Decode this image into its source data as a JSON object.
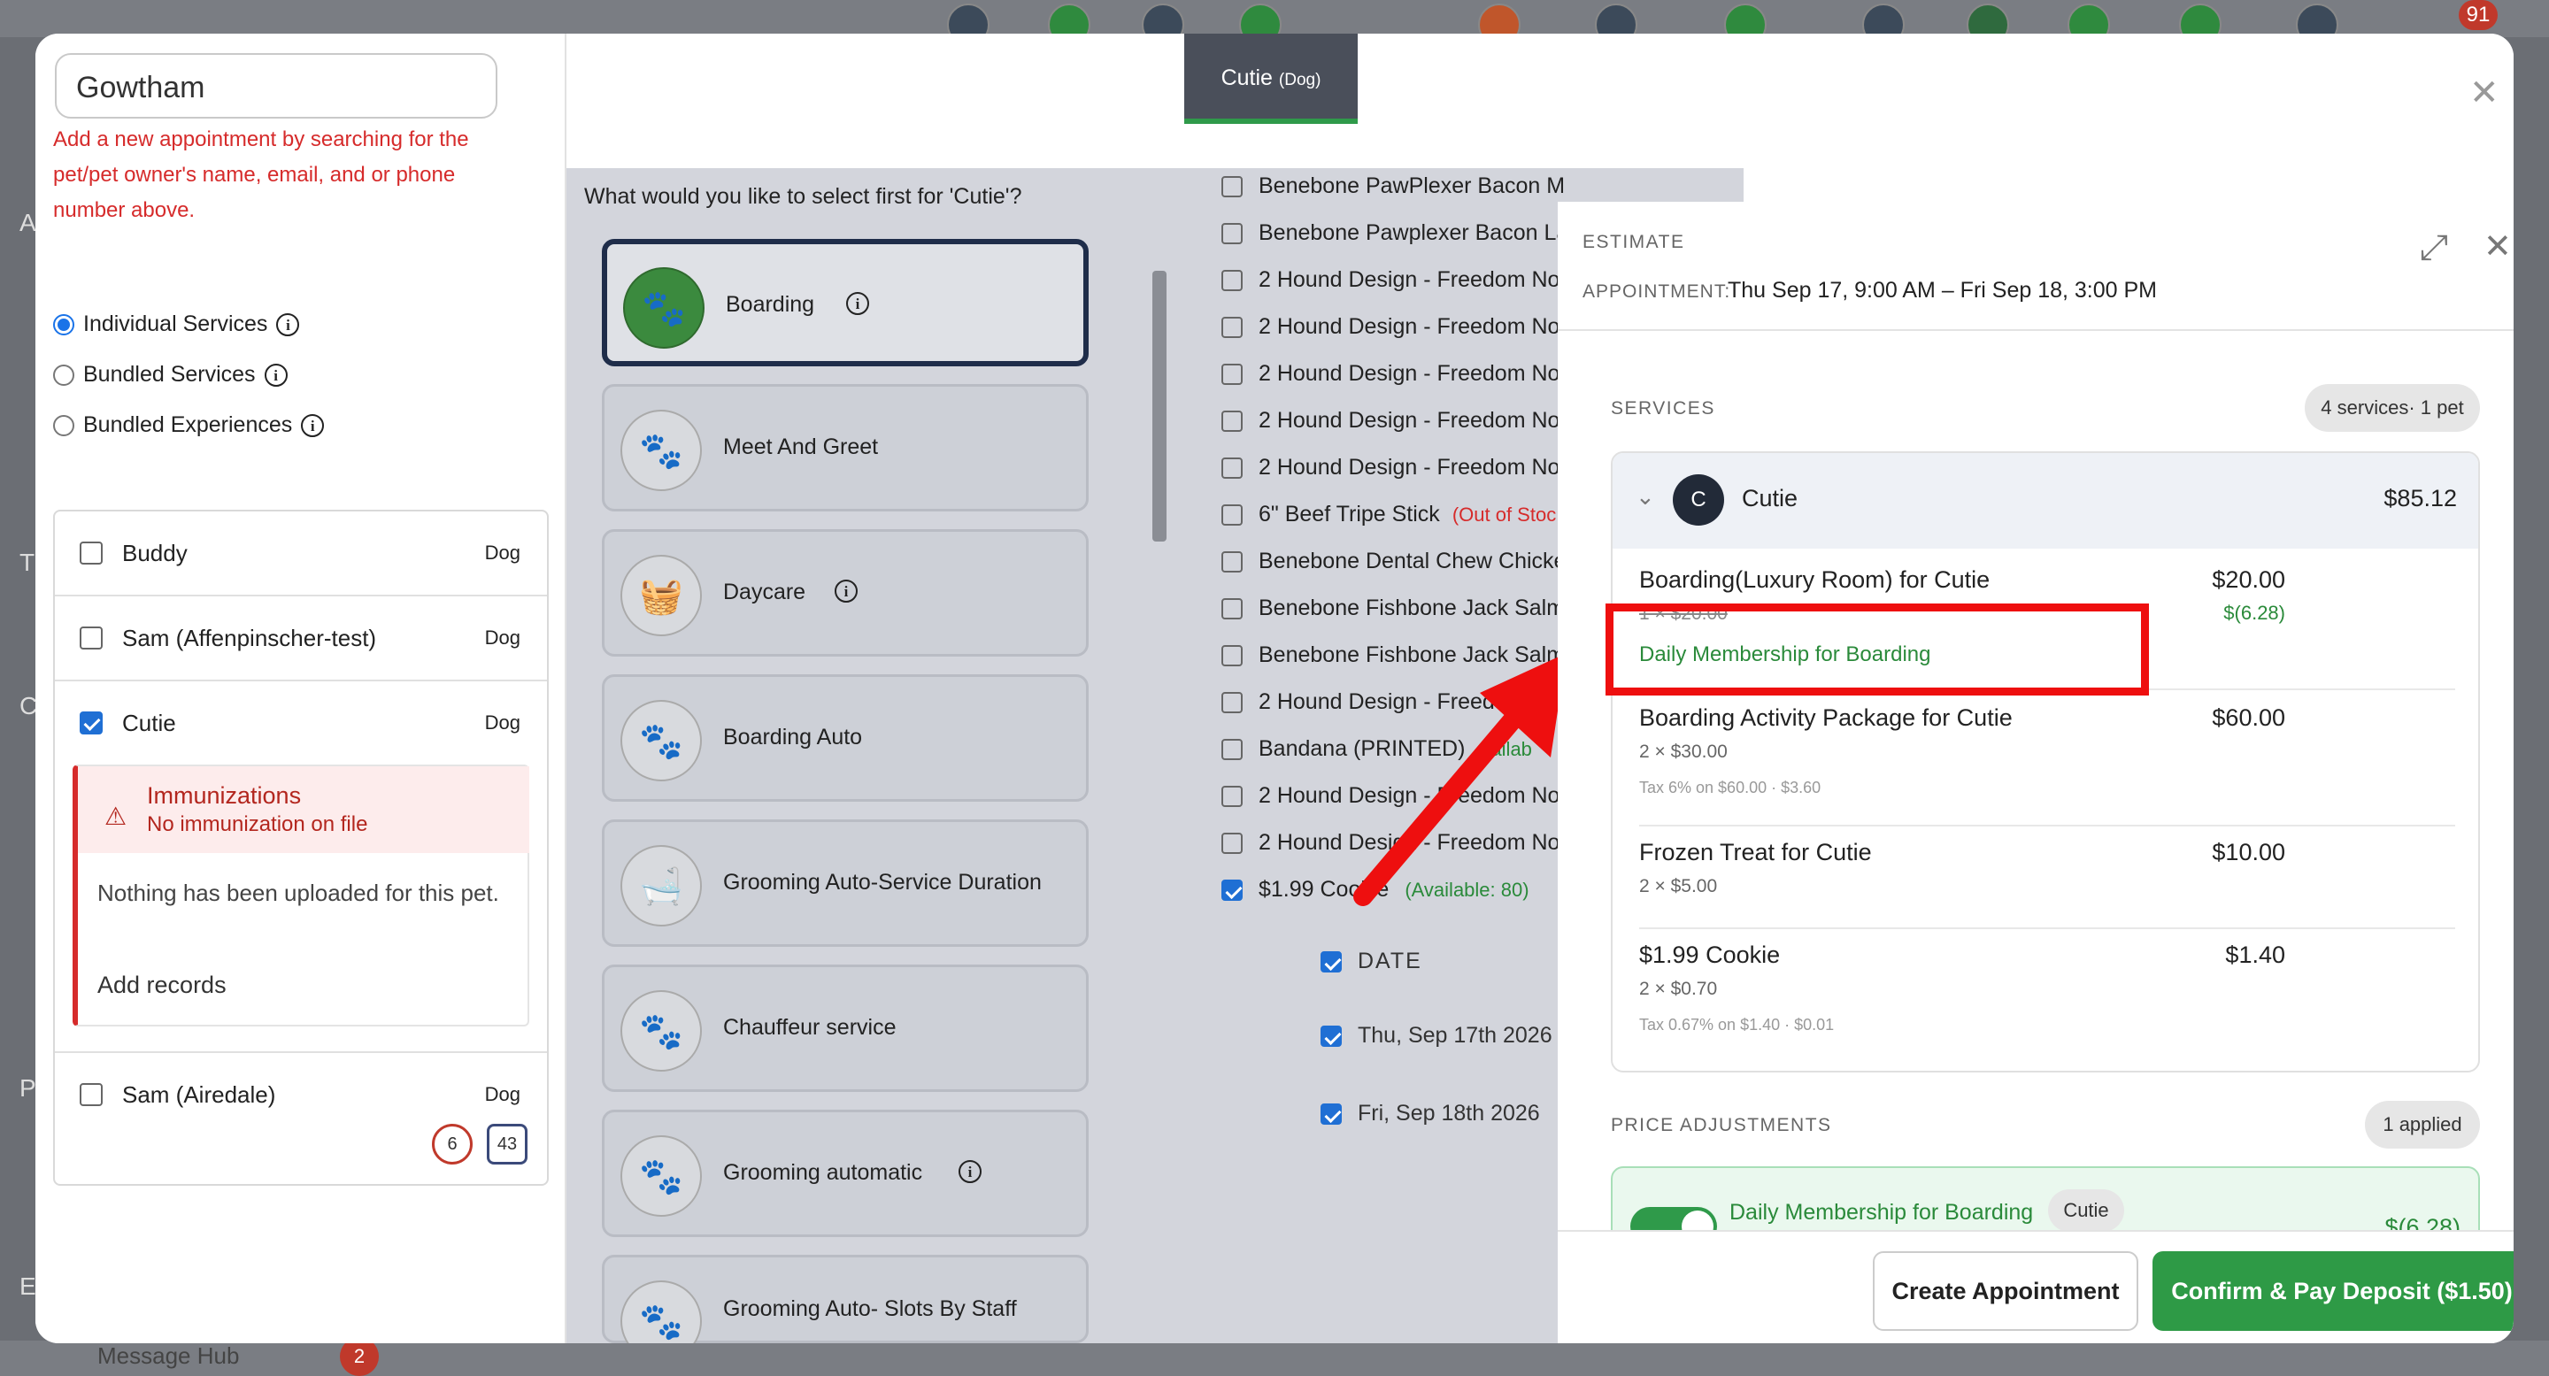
{
  "background": {
    "notification_count": "91",
    "left_letters": [
      "A",
      "T",
      "C",
      "P",
      "E"
    ],
    "bottom_label": "Message Hub",
    "bottom_count": "2"
  },
  "search": {
    "value": "Gowtham"
  },
  "error_text": "Add a new appointment by searching for the pet/pet owner's name, email, and or phone number above.",
  "service_type_options": [
    {
      "label": "Individual Services",
      "selected": true
    },
    {
      "label": "Bundled Services",
      "selected": false
    },
    {
      "label": "Bundled Experiences",
      "selected": false
    }
  ],
  "pets": [
    {
      "name": "Buddy",
      "species": "Dog",
      "checked": false
    },
    {
      "name": "Sam (Affenpinscher-test)",
      "species": "Dog",
      "checked": false
    },
    {
      "name": "Cutie",
      "species": "Dog",
      "checked": true
    },
    {
      "name": "Sam (Airedale)",
      "species": "Dog",
      "checked": false
    }
  ],
  "immunization": {
    "title": "Immunizations",
    "subtitle": "No immunization on file",
    "body": "Nothing has been uploaded for this pet.",
    "link": "Add records"
  },
  "pet_badges": {
    "count1": "6",
    "count2": "43"
  },
  "tab": {
    "name": "Cutie",
    "species": "(Dog)"
  },
  "question": "What would you like to select first for 'Cutie'?",
  "services": [
    "Boarding",
    "Meet And Greet",
    "Daycare",
    "Boarding Auto",
    "Grooming Auto-Service Duration",
    "Chauffeur service",
    "Grooming automatic",
    "Grooming Auto- Slots By Staff"
  ],
  "products": [
    {
      "name": "Benebone PawPlexer Bacon M",
      "checked": false
    },
    {
      "name": "Benebone Pawplexer Bacon La",
      "checked": false
    },
    {
      "name": "2 Hound Design - Freedom No",
      "checked": false
    },
    {
      "name": "2 Hound Design - Freedom No",
      "checked": false
    },
    {
      "name": "2 Hound Design - Freedom No",
      "checked": false
    },
    {
      "name": "2 Hound Design - Freedom No",
      "checked": false
    },
    {
      "name": "2 Hound Design - Freedom No",
      "checked": false
    },
    {
      "name": "6\" Beef Tripe Stick",
      "checked": false,
      "note": "(Out of Stoc"
    },
    {
      "name": "Benebone Dental Chew Chicke",
      "checked": false
    },
    {
      "name": "Benebone Fishbone Jack Salm",
      "checked": false
    },
    {
      "name": "Benebone Fishbone Jack Salm",
      "checked": false
    },
    {
      "name": "2 Hound Design - Freedom N",
      "checked": false
    },
    {
      "name": "Bandana (PRINTED)",
      "checked": false,
      "avail": "vailab"
    },
    {
      "name": "2 Hound Design - Freedom No",
      "checked": false
    },
    {
      "name": "2 Hound Design - Freedom No",
      "checked": false
    },
    {
      "name": "$1.99 Cookie",
      "checked": true,
      "avail": "(Available: 80)"
    }
  ],
  "dates": {
    "header": "DATE",
    "rows": [
      "Thu, Sep 17th 2026",
      "Fri, Sep 18th 2026"
    ]
  },
  "estimate": {
    "label": "ESTIMATE",
    "appointment_label": "APPOINTMENT:",
    "appointment_value": "Thu Sep 17, 9:00 AM – Fri Sep 18, 3:00 PM",
    "services_label": "SERVICES",
    "services_pill": "4 services· 1 pet",
    "pet_initial": "C",
    "pet_name": "Cutie",
    "pet_total": "$85.12",
    "lines": [
      {
        "title": "Boarding(Luxury Room) for Cutie",
        "price": "$20.00",
        "discount": "$(6.28)",
        "sub": "1 × $20.00",
        "membership": "Daily Membership for Boarding"
      },
      {
        "title": "Boarding Activity Package for Cutie",
        "price": "$60.00",
        "sub": "2 × $30.00",
        "tax": "Tax 6% on $60.00 · $3.60"
      },
      {
        "title": "Frozen Treat for Cutie",
        "price": "$10.00",
        "sub": "2 × $5.00"
      },
      {
        "title": "$1.99 Cookie",
        "price": "$1.40",
        "sub": "2 × $0.70",
        "tax": "Tax 0.67% on $1.40 · $0.01"
      }
    ],
    "adjust_label": "PRICE ADJUSTMENTS",
    "adjust_pill": "1 applied",
    "adjust_name": "Daily Membership for Boarding",
    "adjust_pet": "Cutie",
    "adjust_amount": "$(6.28)",
    "create_button": "Create Appointment",
    "confirm_button": "Confirm & Pay Deposit ($1.50)"
  },
  "colors": {
    "accent_green": "#2e9a46",
    "error_red": "#d62b2b",
    "highlight_red": "#ee0f0f",
    "tab_bg": "#4a4f5a"
  }
}
